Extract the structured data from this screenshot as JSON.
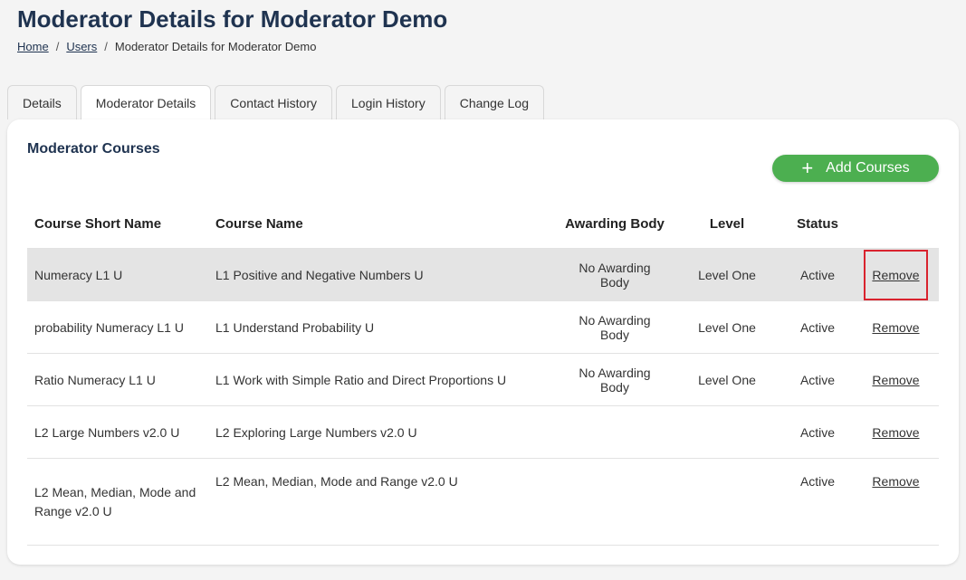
{
  "page": {
    "title": "Moderator Details for Moderator Demo"
  },
  "breadcrumb": {
    "home": "Home",
    "users": "Users",
    "current": "Moderator Details for Moderator Demo",
    "separator": "/"
  },
  "tabs": [
    {
      "label": "Details",
      "active": false
    },
    {
      "label": "Moderator Details",
      "active": true
    },
    {
      "label": "Contact History",
      "active": false
    },
    {
      "label": "Login History",
      "active": false
    },
    {
      "label": "Change Log",
      "active": false
    }
  ],
  "section": {
    "title": "Moderator Courses",
    "add_button": "Add Courses",
    "add_icon": "plus-icon"
  },
  "table": {
    "headers": {
      "short_name": "Course Short Name",
      "course_name": "Course Name",
      "awarding_body": "Awarding Body",
      "level": "Level",
      "status": "Status"
    },
    "rows": [
      {
        "short_name": "Numeracy L1 U",
        "course_name": "L1 Positive and Negative Numbers U",
        "awarding_body": "No Awarding Body",
        "level": "Level One",
        "status": "Active",
        "action": "Remove"
      },
      {
        "short_name": "probability Numeracy L1 U",
        "course_name": "L1 Understand Probability U",
        "awarding_body": "No Awarding Body",
        "level": "Level One",
        "status": "Active",
        "action": "Remove"
      },
      {
        "short_name": "Ratio Numeracy L1 U",
        "course_name": "L1 Work with Simple Ratio and Direct Proportions U",
        "awarding_body": "No Awarding Body",
        "level": "Level One",
        "status": "Active",
        "action": "Remove"
      },
      {
        "short_name": "L2 Large Numbers v2.0 U",
        "course_name": "L2 Exploring Large Numbers v2.0 U",
        "awarding_body": "",
        "level": "",
        "status": "Active",
        "action": "Remove"
      },
      {
        "short_name": "L2 Mean, Median, Mode and Range v2.0 U",
        "course_name": "L2 Mean, Median, Mode and Range v2.0 U",
        "awarding_body": "",
        "level": "",
        "status": "Active",
        "action": "Remove"
      }
    ]
  },
  "colors": {
    "title": "#1f3350",
    "button": "#4caf50",
    "highlight_row": "#e4e4e4",
    "focus_outline": "#d9232e"
  }
}
